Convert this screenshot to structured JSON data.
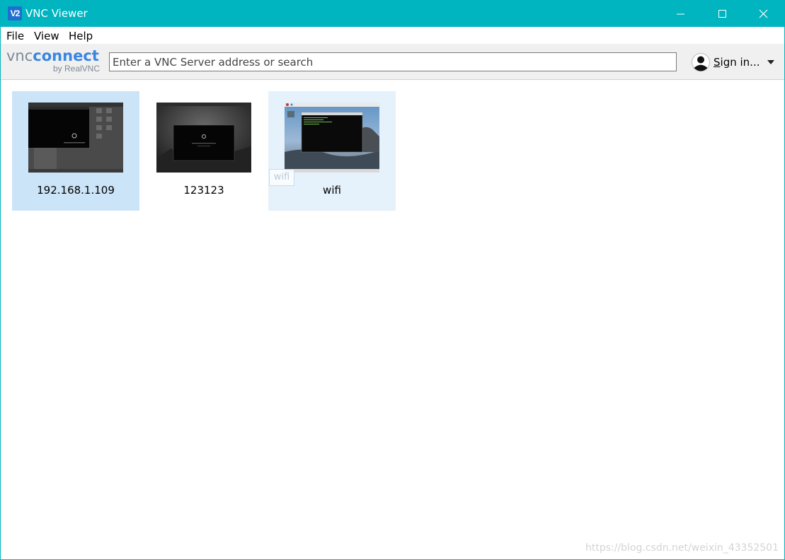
{
  "window": {
    "title": "VNC Viewer",
    "icon_text": "V2",
    "accent_color": "#00b4c0",
    "controls": {
      "minimize": "minimize-icon",
      "maximize": "maximize-icon",
      "close": "close-icon"
    }
  },
  "menu": {
    "file": "File",
    "view": "View",
    "help": "Help"
  },
  "toolbar": {
    "logo_vnc": "vnc",
    "logo_connect": "connect",
    "logo_sub": "by RealVNC",
    "search_placeholder": "Enter a VNC Server address or search",
    "search_value": "",
    "signin_label_first": "S",
    "signin_label_rest": "ign in...",
    "avatar_icon": "user-avatar-icon",
    "caret_icon": "chevron-down-icon"
  },
  "connections": [
    {
      "name": "192.168.1.109",
      "state": "selected",
      "thumbnail": "dark desktop with file manager"
    },
    {
      "name": "123123",
      "state": "normal",
      "thumbnail": "dark desktop"
    },
    {
      "name": "wifi",
      "state": "hover",
      "thumbnail": "desktop with terminal"
    }
  ],
  "drag_ghost_label": "wifi",
  "watermark": "https://blog.csdn.net/weixin_43352501"
}
